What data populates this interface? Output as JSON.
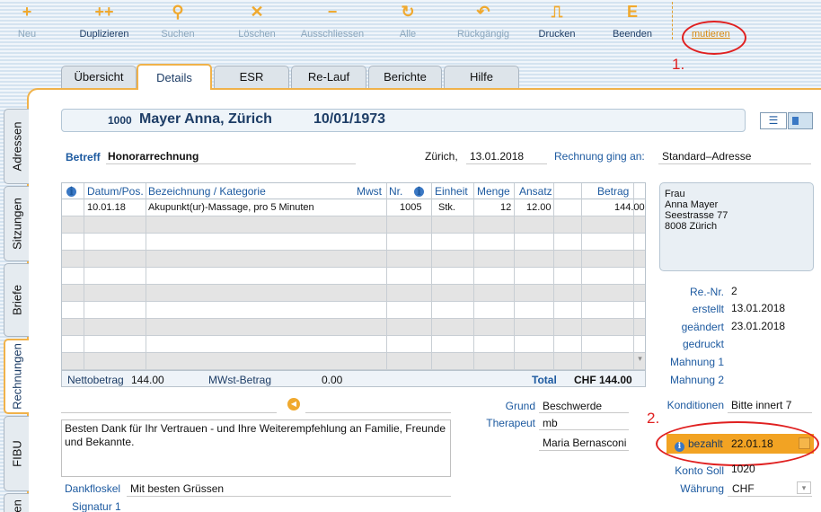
{
  "toolbar": {
    "items": [
      {
        "label": "Neu",
        "icon": "+",
        "enabled": false
      },
      {
        "label": "Duplizieren",
        "icon": "++",
        "enabled": true
      },
      {
        "label": "Suchen",
        "icon": "⚲",
        "enabled": false
      },
      {
        "label": "Löschen",
        "icon": "✕",
        "enabled": false
      },
      {
        "label": "Ausschliessen",
        "icon": "−",
        "enabled": false
      },
      {
        "label": "Alle",
        "icon": "↻",
        "enabled": false
      },
      {
        "label": "Rückgängig",
        "icon": "↶",
        "enabled": false
      },
      {
        "label": "Drucken",
        "icon": "⎍",
        "enabled": true
      },
      {
        "label": "Beenden",
        "icon": "E",
        "enabled": true
      }
    ],
    "mutieren": "mutieren"
  },
  "annotations": {
    "one": "1.",
    "two": "2."
  },
  "tabs": [
    "Übersicht",
    "Details",
    "ESR",
    "Re-Lauf",
    "Berichte",
    "Hilfe"
  ],
  "side_tabs": [
    "Adressen",
    "Sitzungen",
    "Briefe",
    "Rechnungen",
    "FIBU",
    "gen"
  ],
  "header": {
    "id": "1000",
    "name": "Mayer Anna, Zürich",
    "date": "10/01/1973"
  },
  "betreff": {
    "label": "Betreff",
    "value": "Honorarrechnung"
  },
  "place": {
    "city": "Zürich,",
    "date": "13.01.2018"
  },
  "recipient": {
    "label": "Rechnung ging an:",
    "value": "Standard–Adresse"
  },
  "table": {
    "headers": {
      "datum": "Datum/Pos.",
      "bez": "Bezeichnung / Kategorie",
      "mwst": "Mwst",
      "nr": "Nr.",
      "einheit": "Einheit",
      "menge": "Menge",
      "ansatz": "Ansatz",
      "betrag": "Betrag"
    },
    "row": {
      "datum": "10.01.18",
      "bez": "Akupunkt(ur)-Massage, pro 5 Minuten",
      "nr": "1005",
      "einheit": "Stk.",
      "menge": "12",
      "ansatz": "12.00",
      "betrag": "144.00"
    },
    "footer": {
      "netto_label": "Nettobetrag",
      "netto": "144.00",
      "mwst_label": "MWst-Betrag",
      "mwst": "0.00",
      "total_label": "Total",
      "total": "CHF 144.00"
    }
  },
  "address": [
    "Frau",
    "Anna Mayer",
    "Seestrasse 77",
    "8008 Zürich"
  ],
  "invoice": {
    "re_nr_label": "Re.-Nr.",
    "re_nr": "2",
    "erstellt_label": "erstellt",
    "erstellt": "13.01.2018",
    "geaendert_label": "geändert",
    "geaendert": "23.01.2018",
    "gedruckt_label": "gedruckt",
    "mahnung1_label": "Mahnung 1",
    "mahnung2_label": "Mahnung 2",
    "konditionen_label": "Konditionen",
    "konditionen": "Bitte innert 7",
    "bezahlt_label": "bezahlt",
    "bezahlt": "22.01.18",
    "konto_label": "Konto Soll",
    "konto": "1020",
    "waehrung_label": "Währung",
    "waehrung": "CHF"
  },
  "grund": {
    "label": "Grund",
    "value": "Beschwerde"
  },
  "therapeut": {
    "label": "Therapeut",
    "value": "mb",
    "name": "Maria Bernasconi"
  },
  "message": "Besten Dank für Ihr Vertrauen - und Ihre Weiterempfehlung an Familie, Freunde und Bekannte.",
  "dankfloskel": {
    "label": "Dankfloskel",
    "value": "Mit besten Grüssen"
  },
  "signatur": {
    "label": "Signatur 1"
  },
  "colors": {
    "accent": "#f0b24a",
    "label_blue": "#1d5aa0",
    "annotation_red": "#e02020",
    "paid_orange": "#f2a323"
  }
}
